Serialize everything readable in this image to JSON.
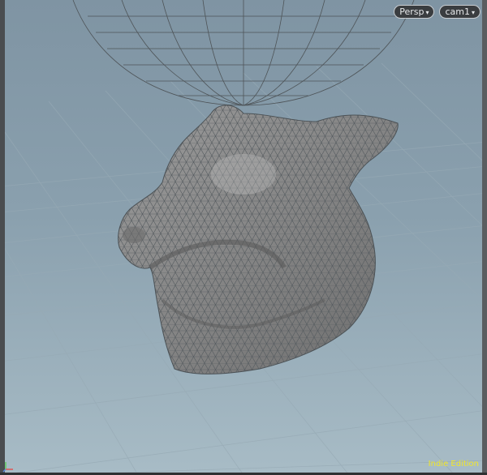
{
  "viewport": {
    "camera_view_label": "Persp",
    "camera_label": "cam1",
    "edition_label": "Indie Edition",
    "caret_glyph": "▾",
    "background_top": "#7f94a3",
    "background_bottom": "#a8bcc6",
    "grid_color": "#95a8b4",
    "mesh_color": "#8c8c8c",
    "wire_color": "#4b5155",
    "edition_color": "#f2e62a"
  },
  "icons": {
    "view_dropdown": "chevron-down-icon",
    "axis_gizmo": "axis-gizmo-icon"
  }
}
